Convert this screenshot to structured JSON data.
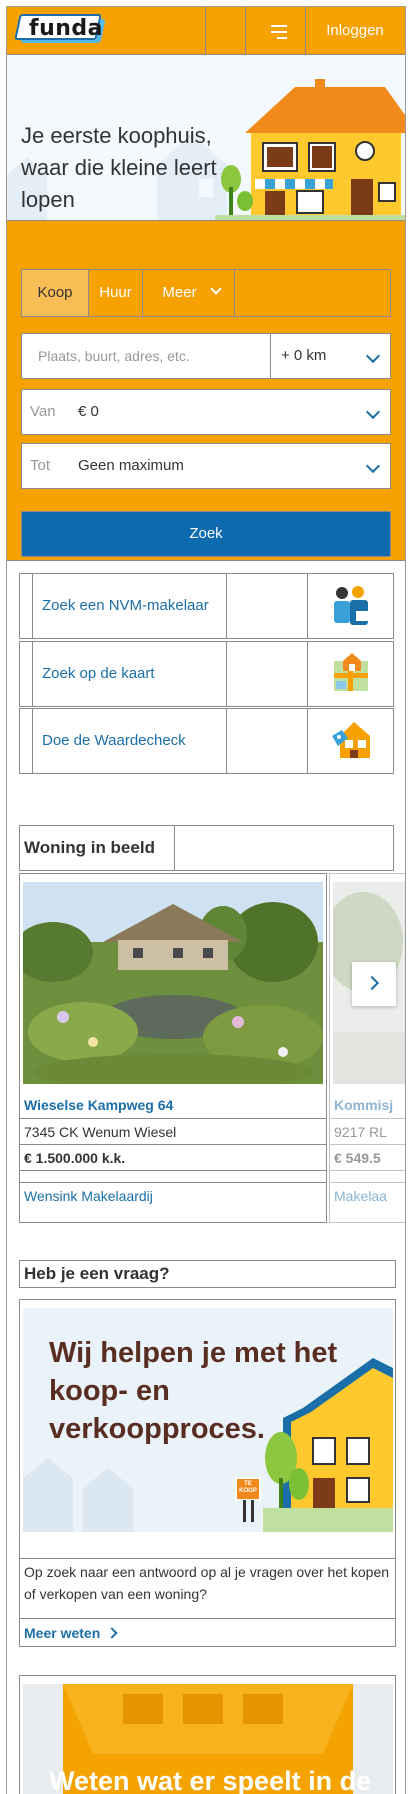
{
  "header": {
    "logo_text": "funda",
    "login_label": "Inloggen"
  },
  "hero": {
    "text": "Je eerste koophuis, waar die kleine leert lopen"
  },
  "search": {
    "tabs": [
      {
        "label": "Koop"
      },
      {
        "label": "Huur"
      },
      {
        "label": "Meer"
      }
    ],
    "location_placeholder": "Plaats, buurt, adres, etc.",
    "radius_value": "+ 0 km",
    "from_label": "Van",
    "from_value": "€ 0",
    "to_label": "Tot",
    "to_value": "Geen maximum",
    "submit_label": "Zoek"
  },
  "quick_links": [
    {
      "label": "Zoek een NVM-makelaar",
      "icon": "makelaar-icon"
    },
    {
      "label": "Zoek op de kaart",
      "icon": "map-icon"
    },
    {
      "label": "Doe de Waardecheck",
      "icon": "waardecheck-icon"
    }
  ],
  "woning_in_beeld": {
    "title": "Woning in beeld",
    "cards": [
      {
        "street": "Wieselse Kampweg 64",
        "city": "7345 CK Wenum Wiesel",
        "price": "€ 1.500.000 k.k.",
        "broker": "Wensink Makelaardij"
      },
      {
        "street": "Kommisj",
        "city": "9217 RL",
        "price": "€ 549.5",
        "broker": "Makelaa"
      }
    ]
  },
  "vraag": {
    "title": "Heb je een vraag?",
    "headline": "Wij helpen je met het koop- en verkoopproces.",
    "sign_text": "TE KOOP",
    "description": "Op zoek naar een antwoord op al je vragen over het kopen of verkopen van een woning?",
    "more_label": "Meer weten"
  },
  "promo": {
    "text": "Weten wat er speelt in de"
  },
  "colors": {
    "brand_orange": "#f7a100",
    "link_blue": "#1b6fa8",
    "button_blue": "#0e6aaf"
  }
}
